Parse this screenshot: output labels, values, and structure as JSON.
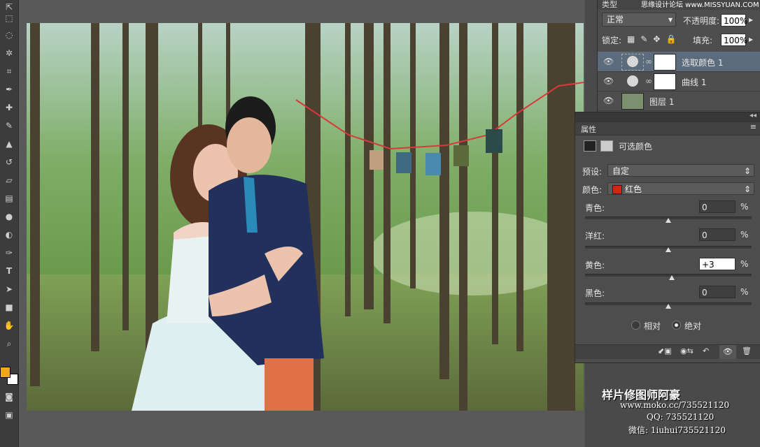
{
  "topbar": {
    "blend_mode": "正常",
    "opacity_label": "不透明度:",
    "opacity_value": "100%",
    "lock_label": "锁定:",
    "fill_label": "填充:",
    "fill_value": "100%",
    "filter_label": "类型",
    "site_watermark": "思缘设计论坛 www.MISSYUAN.COM"
  },
  "layers": [
    {
      "name": "选取颜色 1",
      "selected": true
    },
    {
      "name": "曲线 1",
      "selected": false
    },
    {
      "name": "图层 1",
      "selected": false
    }
  ],
  "properties": {
    "tab": "属性",
    "title": "可选颜色",
    "preset_label": "预设:",
    "preset_value": "自定",
    "color_label": "颜色:",
    "color_value": "红色",
    "color_swatch": "#cc2a10",
    "sliders": [
      {
        "label": "青色:",
        "value": "0",
        "pos": 0.5
      },
      {
        "label": "洋红:",
        "value": "0",
        "pos": 0.5
      },
      {
        "label": "黄色:",
        "value": "+3",
        "pos": 0.52
      },
      {
        "label": "黑色:",
        "value": "0",
        "pos": 0.5
      }
    ],
    "percent": "%",
    "radio_relative": "相对",
    "radio_absolute": "绝对"
  },
  "watermark": {
    "line1": "样片修图师阿豪",
    "line2": "www.moko.cc/735521120",
    "line3": "QQ: 735521120",
    "line4": "微信: 1iuhui735521120"
  },
  "colors": {
    "foreground": "#f0a818",
    "background": "#ffffff"
  }
}
